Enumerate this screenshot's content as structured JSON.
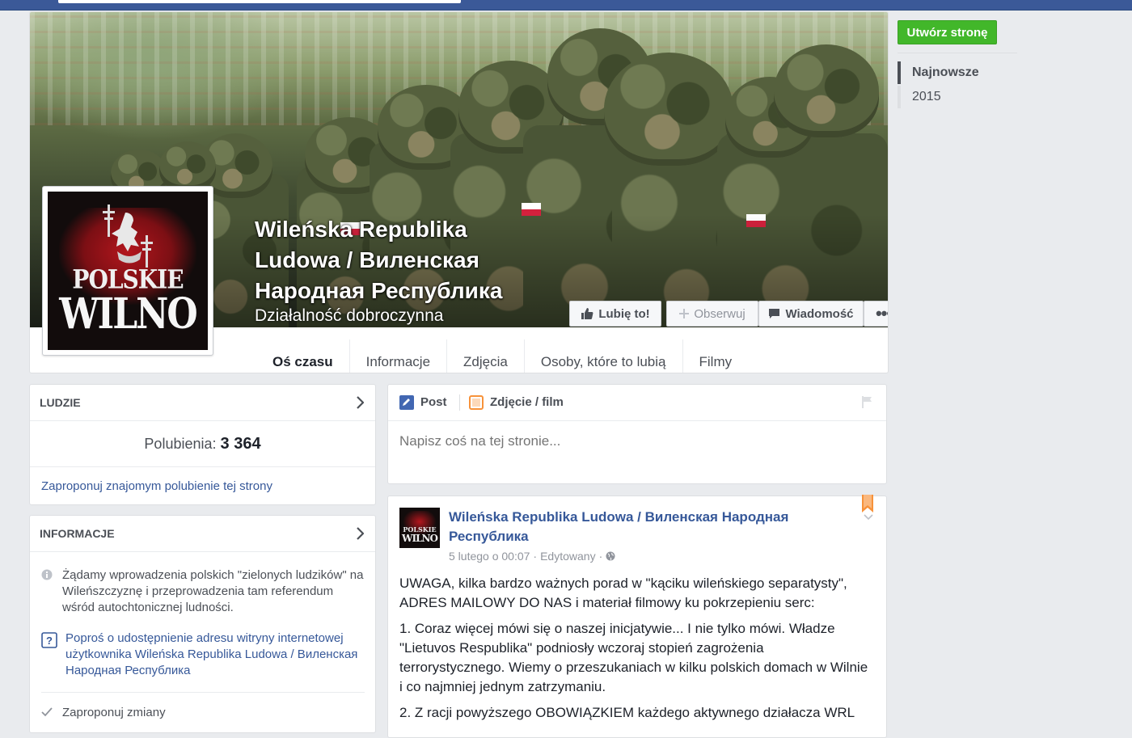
{
  "page": {
    "name": "Wileńska Republika Ludowa / Виленская Народная Республика",
    "category": "Działalność dobroczynna",
    "profile_text_1": "POLSKIE",
    "profile_text_2": "WILNO"
  },
  "actions": {
    "like": "Lubię to!",
    "follow": "Obserwuj",
    "message": "Wiadomość",
    "more": "•••"
  },
  "tabs": [
    "Oś czasu",
    "Informacje",
    "Zdjęcia",
    "Osoby, które to lubią",
    "Filmy"
  ],
  "sidebar_right": {
    "create_page": "Utwórz stronę",
    "nav": [
      "Najnowsze",
      "2015"
    ]
  },
  "ludzie": {
    "title": "LUDZIE",
    "likes_label": "Polubienia:",
    "likes_count": "3 364",
    "invite": "Zaproponuj znajomym polubienie tej strony"
  },
  "informacje": {
    "title": "INFORMACJE",
    "description": "Żądamy wprowadzenia polskich \"zielonych ludzików\" na Wileńszczyznę i przeprowadzenia tam referendum wśród autochtonicznej ludności.",
    "ask_address": "Poproś o udostępnienie adresu witryny internetowej użytkownika Wileńska Republika Ludowa / Виленская Народная Республика",
    "suggest": "Zaproponuj zmiany"
  },
  "composer": {
    "post_tab": "Post",
    "photo_tab": "Zdjęcie / film",
    "placeholder": "Napisz coś na tej stronie..."
  },
  "post": {
    "author": "Wileńska Republika Ludowa / Виленская Народная Республика",
    "date": "5 lutego o 00:07",
    "sep": "·",
    "edited": "Edytowany",
    "sep2": "·",
    "para1": "UWAGA, kilka bardzo ważnych porad w \"kąciku wileńskiego separatysty\", ADRES MAILOWY DO NAS i materiał filmowy ku pokrzepieniu serc:",
    "para2": "1. Coraz więcej mówi się o naszej inicjatywie... I nie tylko mówi. Władze \"Lietuvos Respublika\" podniosły wczoraj stopień zagrożenia terrorystycznego. Wiemy o przeszukaniach w kilku polskich domach w Wilnie i co najmniej jednym zatrzymaniu.",
    "para3": "2. Z racji powyższego OBOWIĄZKIEM każdego aktywnego działacza WRL"
  },
  "colors": {
    "topbar": "#3b5998",
    "link": "#365899",
    "green_button": "#42b72a",
    "tab_underline": "#4267b2",
    "bookmark": "#f7923a"
  }
}
